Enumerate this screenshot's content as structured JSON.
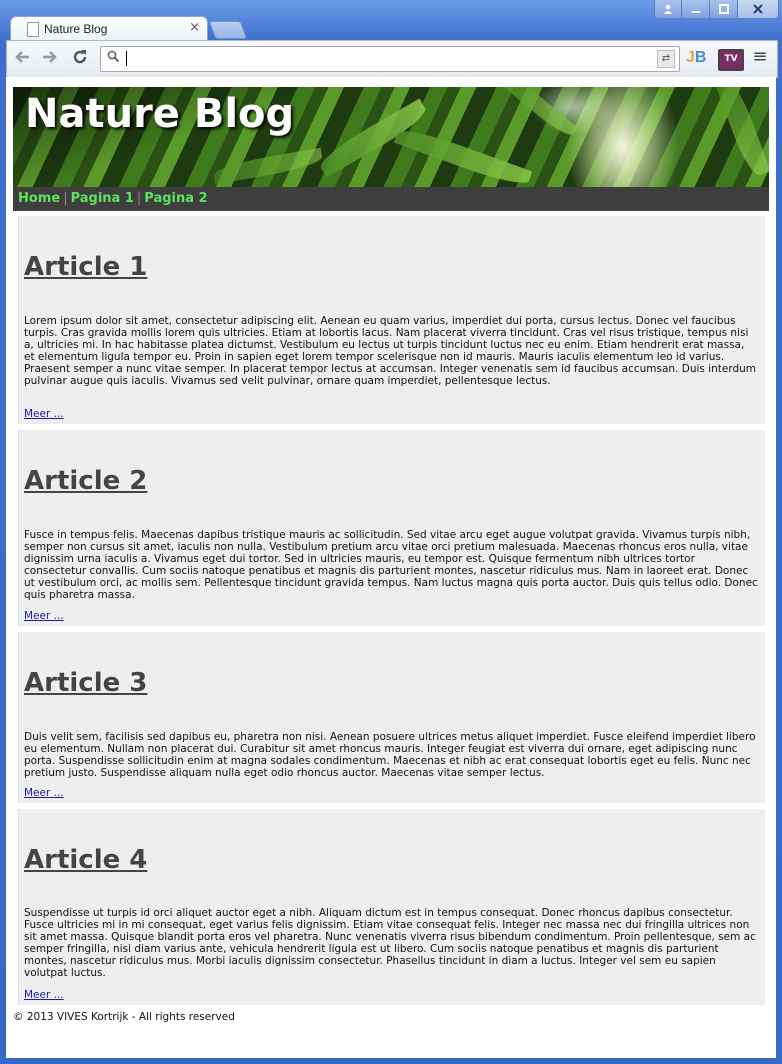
{
  "browser": {
    "tab_title": "Nature Blog",
    "tab_close": "×",
    "address": "",
    "ext_jb_j": "J",
    "ext_jb_b": "B",
    "ext_tv": "TV",
    "menu": "≡"
  },
  "site": {
    "title": "Nature Blog",
    "nav": [
      {
        "label": "Home"
      },
      {
        "label": "Pagina 1"
      },
      {
        "label": "Pagina 2"
      }
    ],
    "nav_separator": "|"
  },
  "articles": [
    {
      "title": "Article 1",
      "body": "Lorem ipsum dolor sit amet, consectetur adipiscing elit. Aenean eu quam varius, imperdiet dui porta, cursus lectus. Donec vel faucibus turpis. Cras gravida mollis lorem quis ultricies. Etiam at lobortis lacus. Nam placerat viverra tincidunt. Cras vel risus tristique, tempus nisi a, ultricies mi. In hac habitasse platea dictumst. Vestibulum eu lectus ut turpis tincidunt luctus nec eu enim. Etiam hendrerit erat massa, et elementum ligula tempor eu. Proin in sapien eget lorem tempor scelerisque non id mauris. Mauris iaculis elementum leo id varius. Praesent semper a nunc vitae semper. In placerat tempor lectus at accumsan. Integer venenatis sem id faucibus accumsan. Duis interdum pulvinar augue quis iaculis. Vivamus sed velit pulvinar, ornare quam imperdiet, pellentesque lectus.",
      "more": "Meer ..."
    },
    {
      "title": "Article 2",
      "body": "Fusce in tempus felis. Maecenas dapibus tristique mauris ac sollicitudin. Sed vitae arcu eget augue volutpat gravida. Vivamus turpis nibh, semper non cursus sit amet, iaculis non nulla. Vestibulum pretium arcu vitae orci pretium malesuada. Maecenas rhoncus eros nulla, vitae dignissim urna iaculis a. Vivamus eget dui tortor. Sed in ultricies mauris, eu tempor est. Quisque fermentum nibh ultrices tortor consectetur convallis. Cum sociis natoque penatibus et magnis dis parturient montes, nascetur ridiculus mus. Nam in laoreet erat. Donec ut vestibulum orci, ac mollis sem. Pellentesque tincidunt gravida tempus. Nam luctus magna quis porta auctor. Duis quis tellus odio. Donec quis pharetra massa.",
      "more": "Meer ..."
    },
    {
      "title": "Article 3",
      "body": "Duis velit sem, facilisis sed dapibus eu, pharetra non nisi. Aenean posuere ultrices metus aliquet imperdiet. Fusce eleifend imperdiet libero eu elementum. Nullam non placerat dui. Curabitur sit amet rhoncus mauris. Integer feugiat est viverra dui ornare, eget adipiscing nunc porta. Suspendisse sollicitudin enim at magna sodales condimentum. Maecenas et nibh ac erat consequat lobortis eget eu felis. Nunc nec pretium justo. Suspendisse aliquam nulla eget odio rhoncus auctor. Maecenas vitae semper lectus.",
      "more": "Meer ..."
    },
    {
      "title": "Article 4",
      "body": "Suspendisse ut turpis id orci aliquet auctor eget a nibh. Aliquam dictum est in tempus consequat. Donec rhoncus dapibus consectetur. Fusce ultricies mi in mi consequat, eget varius felis dignissim. Etiam vitae consequat felis. Integer nec massa nec dui fringilla ultrices non sit amet massa. Quisque blandit porta eros vel pharetra. Nunc venenatis viverra risus bibendum condimentum. Proin pellentesque, sem ac semper fringilla, nisi diam varius ante, vehicula hendrerit ligula est ut libero. Cum sociis natoque penatibus et magnis dis parturient montes, nascetur ridiculus mus. Morbi iaculis dignissim consectetur. Phasellus tincidunt in diam a luctus. Integer vel sem eu sapien volutpat luctus.",
      "more": "Meer ..."
    }
  ],
  "footer": "© 2013 VIVES Kortrijk - All rights reserved"
}
